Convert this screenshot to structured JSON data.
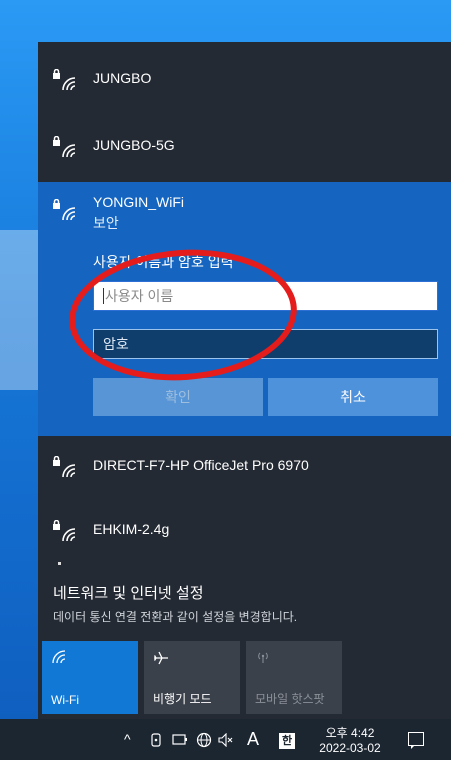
{
  "networks": [
    {
      "ssid": "JUNGBO",
      "icon": "wifi-secured-icon"
    },
    {
      "ssid": "JUNGBO-5G",
      "icon": "wifi-secured-icon"
    },
    {
      "ssid": "DIRECT-F7-HP OfficeJet Pro 6970",
      "icon": "wifi-secured-icon"
    },
    {
      "ssid": "EHKIM-2.4g",
      "icon": "wifi-secured-icon"
    }
  ],
  "expanded": {
    "ssid": "YONGIN_WiFi",
    "security": "보안",
    "prompt": "사용자 이름과 암호 입력",
    "username_placeholder": "사용자 이름",
    "password_placeholder": "암호",
    "ok_label": "확인",
    "cancel_label": "취소"
  },
  "settings": {
    "link": "네트워크 및 인터넷 설정",
    "description": "데이터 통신 연결 전환과 같이 설정을 변경합니다."
  },
  "quick_actions": [
    {
      "label": "Wi-Fi",
      "icon": "wifi-icon",
      "state": "on"
    },
    {
      "label": "비행기 모드",
      "icon": "airplane-icon",
      "state": "off"
    },
    {
      "label": "모바일 핫스팟",
      "icon": "hotspot-icon",
      "state": "disabled"
    }
  ],
  "taskbar": {
    "tray_chevron": "^",
    "ime_letter": "A",
    "ime_han": "한",
    "time": "오후 4:42",
    "date": "2022-03-02"
  },
  "colors": {
    "panel": "#242a33",
    "selected": "#1565c0",
    "accent": "#1178d6",
    "annotation": "#e41c1c"
  }
}
